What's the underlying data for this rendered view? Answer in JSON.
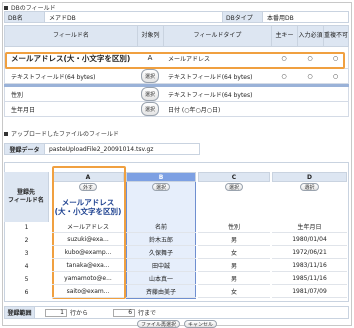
{
  "db_section": {
    "title": "DBのフィールド",
    "db_name_label": "DB名",
    "db_name_value": "メアドDB",
    "db_type_label": "DBタイプ",
    "db_type_value": "本番用DB"
  },
  "field_table": {
    "headers": {
      "field_name": "フィールド名",
      "target_col": "対象列",
      "field_type": "フィールドタイプ",
      "primary_key": "主キー",
      "required": "入力必須",
      "no_dup": "重複不可"
    },
    "rows": [
      {
        "name": "メールアドレス(大・小文字を区別)",
        "target": "A",
        "type": "メールアドレス",
        "pk": "○",
        "req": "○",
        "dup": "○"
      },
      {
        "name": "テキストフィールド(64 bytes)",
        "target_btn": "選択",
        "type": "テキストフィールド(64 bytes)",
        "pk": "○",
        "req": "○",
        "dup": "○"
      },
      {
        "name": "性別",
        "target_btn": "選択",
        "type": "テキストフィールド(64 bytes)",
        "pk": "",
        "req": "",
        "dup": ""
      },
      {
        "name": "生年月日",
        "target_btn": "選択",
        "type": "日付 (○年○月○日)",
        "pk": "",
        "req": "",
        "dup": ""
      }
    ]
  },
  "upload_section": {
    "title": "アップロードしたファイルのフィールド",
    "reg_label": "登録データ",
    "reg_value": "pasteUploadFile2_20091014.tsv.gz",
    "field_name_label": "登録先\nフィールド名",
    "columns": [
      {
        "letter": "A",
        "btn": "外す",
        "mapped": "メールアドレス\n(大・小文字を区別)"
      },
      {
        "letter": "B",
        "btn": "選択",
        "mapped": ""
      },
      {
        "letter": "C",
        "btn": "選択",
        "mapped": ""
      },
      {
        "letter": "D",
        "btn": "選択",
        "mapped": ""
      }
    ],
    "rows": [
      {
        "n": "1",
        "a": "メールアドレス",
        "b": "名前",
        "c": "性別",
        "d": "生年月日"
      },
      {
        "n": "2",
        "a": "suzuki@exa...",
        "b": "鈴木五郎",
        "c": "男",
        "d": "1980/01/04"
      },
      {
        "n": "3",
        "a": "kubo@examp...",
        "b": "久保舞子",
        "c": "女",
        "d": "1972/06/21"
      },
      {
        "n": "4",
        "a": "tanaka@exa...",
        "b": "田中誠",
        "c": "男",
        "d": "1983/11/16"
      },
      {
        "n": "5",
        "a": "yamamoto@e...",
        "b": "山本真一",
        "c": "男",
        "d": "1985/11/16"
      },
      {
        "n": "6",
        "a": "saito@exam...",
        "b": "斉藤由美子",
        "c": "女",
        "d": "1981/07/09"
      }
    ]
  },
  "range": {
    "label": "登録範囲",
    "from_value": "1",
    "from_suffix": "行から",
    "to_value": "6",
    "to_suffix": "行まで"
  },
  "footer": {
    "reselect_label": "ファイル再選択",
    "cancel_label": "キャンセル"
  },
  "colors": {
    "highlight_orange": "#f0a040",
    "highlight_blue": "#b8cdf0",
    "header_bg": "#dde6f2"
  }
}
